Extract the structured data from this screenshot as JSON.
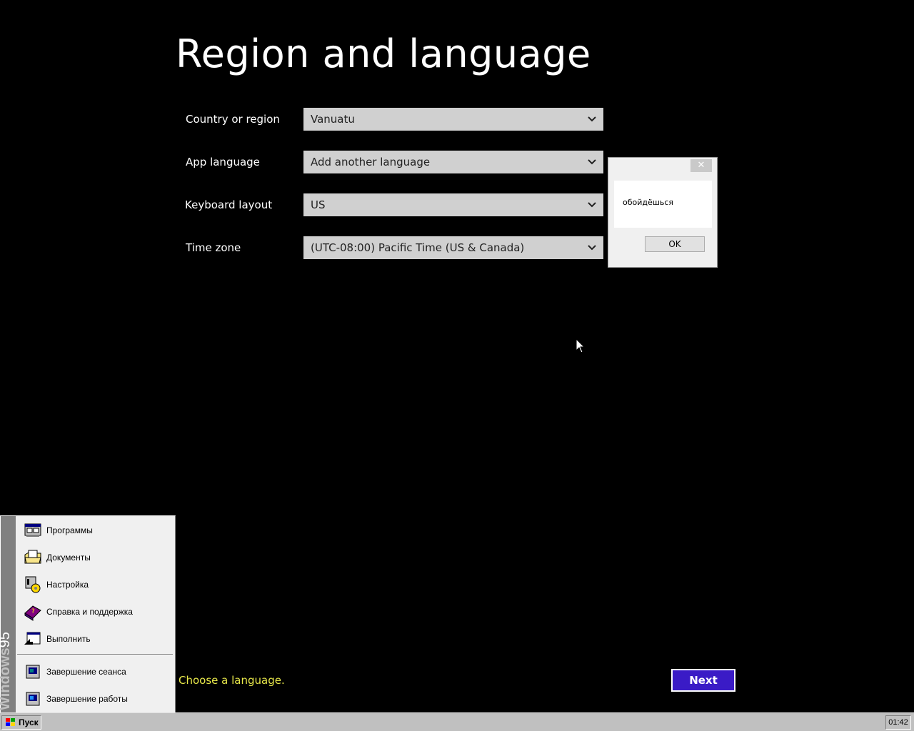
{
  "page": {
    "title": "Region and language",
    "hint": "Choose a language.",
    "next_label": "Next"
  },
  "fields": [
    {
      "label": "Country or region",
      "value": "Vanuatu"
    },
    {
      "label": "App language",
      "value": "Add another language"
    },
    {
      "label": "Keyboard layout",
      "value": "US"
    },
    {
      "label": "Time zone",
      "value": "(UTC-08:00) Pacific Time (US & Canada)"
    }
  ],
  "dialog": {
    "close_glyph": "✕",
    "message": "обойдёшься",
    "ok_label": "OK"
  },
  "start_menu": {
    "brand_bold": "Windows",
    "brand_light": "95",
    "items": [
      {
        "label": "Программы",
        "icon": "programs-icon"
      },
      {
        "label": "Документы",
        "icon": "documents-icon"
      },
      {
        "label": "Настройка",
        "icon": "settings-icon"
      },
      {
        "label": "Справка и поддержка",
        "icon": "help-icon"
      },
      {
        "label": "Выполнить",
        "icon": "run-icon"
      },
      {
        "label": "Завершение сеанса",
        "icon": "logoff-icon"
      },
      {
        "label": "Завершение работы",
        "icon": "shutdown-icon"
      }
    ]
  },
  "taskbar": {
    "start_label": "Пуск",
    "clock": "01:42"
  },
  "colors": {
    "background": "#000000",
    "hint": "#e8e84a",
    "next_button": "#3a1bc6",
    "select_bg": "#d0d0d0"
  }
}
